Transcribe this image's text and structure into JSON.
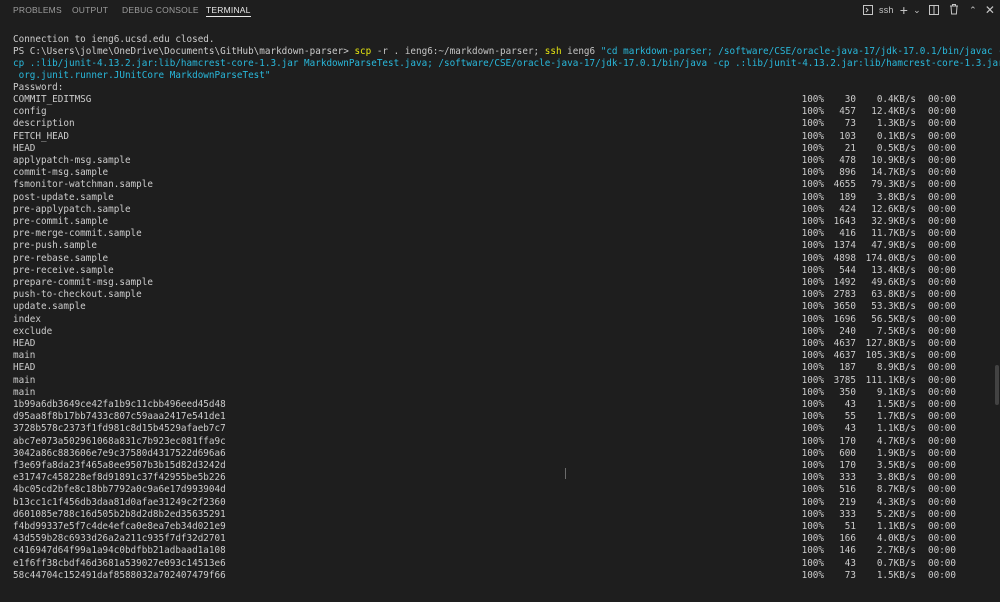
{
  "tabs": [
    {
      "label": "PROBLEMS"
    },
    {
      "label": "OUTPUT"
    },
    {
      "label": "DEBUG CONSOLE"
    },
    {
      "label": "TERMINAL"
    }
  ],
  "toolbar": {
    "shell_label": "ssh",
    "icons": [
      "terminal-icon",
      "plus-icon",
      "chevron-down-icon",
      "split-icon",
      "trash-icon",
      "chevron-up-icon",
      "close-icon"
    ]
  },
  "terminal": {
    "pre_lines": [
      "Connection to ieng6.ucsd.edu closed."
    ],
    "prompt": "PS C:\\Users\\jolme\\OneDrive\\Documents\\GitHub\\markdown-parser> ",
    "cmd_part1": "scp",
    "cmd_part2": " -r . ieng6:~/markdown-parser; ",
    "cmd_part3": "ssh",
    "cmd_part4": " ieng6 ",
    "cmd_str_1": "\"cd markdown-parser; /software/CSE/oracle-java-17/jdk-17.0.1/bin/javac -",
    "cmd_str_2": "cp .:lib/junit-4.13.2.jar:lib/hamcrest-core-1.3.jar MarkdownParseTest.java; /software/CSE/oracle-java-17/jdk-17.0.1/bin/java -cp .:lib/junit-4.13.2.jar:lib/hamcrest-core-1.3.jar",
    "cmd_str_3": " org.junit.runner.JUnitCore MarkdownParseTest\"",
    "password_line": "Password:",
    "transfers": [
      {
        "name": "COMMIT_EDITMSG",
        "pct": "100%",
        "size": "30",
        "speed": "0.4KB/s",
        "eta": "00:00"
      },
      {
        "name": "config",
        "pct": "100%",
        "size": "457",
        "speed": "12.4KB/s",
        "eta": "00:00"
      },
      {
        "name": "description",
        "pct": "100%",
        "size": "73",
        "speed": "1.3KB/s",
        "eta": "00:00"
      },
      {
        "name": "FETCH_HEAD",
        "pct": "100%",
        "size": "103",
        "speed": "0.1KB/s",
        "eta": "00:00"
      },
      {
        "name": "HEAD",
        "pct": "100%",
        "size": "21",
        "speed": "0.5KB/s",
        "eta": "00:00"
      },
      {
        "name": "applypatch-msg.sample",
        "pct": "100%",
        "size": "478",
        "speed": "10.9KB/s",
        "eta": "00:00"
      },
      {
        "name": "commit-msg.sample",
        "pct": "100%",
        "size": "896",
        "speed": "14.7KB/s",
        "eta": "00:00"
      },
      {
        "name": "fsmonitor-watchman.sample",
        "pct": "100%",
        "size": "4655",
        "speed": "79.3KB/s",
        "eta": "00:00"
      },
      {
        "name": "post-update.sample",
        "pct": "100%",
        "size": "189",
        "speed": "3.8KB/s",
        "eta": "00:00"
      },
      {
        "name": "pre-applypatch.sample",
        "pct": "100%",
        "size": "424",
        "speed": "12.6KB/s",
        "eta": "00:00"
      },
      {
        "name": "pre-commit.sample",
        "pct": "100%",
        "size": "1643",
        "speed": "32.9KB/s",
        "eta": "00:00"
      },
      {
        "name": "pre-merge-commit.sample",
        "pct": "100%",
        "size": "416",
        "speed": "11.7KB/s",
        "eta": "00:00"
      },
      {
        "name": "pre-push.sample",
        "pct": "100%",
        "size": "1374",
        "speed": "47.9KB/s",
        "eta": "00:00"
      },
      {
        "name": "pre-rebase.sample",
        "pct": "100%",
        "size": "4898",
        "speed": "174.0KB/s",
        "eta": "00:00"
      },
      {
        "name": "pre-receive.sample",
        "pct": "100%",
        "size": "544",
        "speed": "13.4KB/s",
        "eta": "00:00"
      },
      {
        "name": "prepare-commit-msg.sample",
        "pct": "100%",
        "size": "1492",
        "speed": "49.6KB/s",
        "eta": "00:00"
      },
      {
        "name": "push-to-checkout.sample",
        "pct": "100%",
        "size": "2783",
        "speed": "63.8KB/s",
        "eta": "00:00"
      },
      {
        "name": "update.sample",
        "pct": "100%",
        "size": "3650",
        "speed": "53.3KB/s",
        "eta": "00:00"
      },
      {
        "name": "index",
        "pct": "100%",
        "size": "1696",
        "speed": "56.5KB/s",
        "eta": "00:00"
      },
      {
        "name": "exclude",
        "pct": "100%",
        "size": "240",
        "speed": "7.5KB/s",
        "eta": "00:00"
      },
      {
        "name": "HEAD",
        "pct": "100%",
        "size": "4637",
        "speed": "127.8KB/s",
        "eta": "00:00"
      },
      {
        "name": "main",
        "pct": "100%",
        "size": "4637",
        "speed": "105.3KB/s",
        "eta": "00:00"
      },
      {
        "name": "HEAD",
        "pct": "100%",
        "size": "187",
        "speed": "8.9KB/s",
        "eta": "00:00"
      },
      {
        "name": "main",
        "pct": "100%",
        "size": "3785",
        "speed": "111.1KB/s",
        "eta": "00:00"
      },
      {
        "name": "main",
        "pct": "100%",
        "size": "350",
        "speed": "9.1KB/s",
        "eta": "00:00"
      },
      {
        "name": "1b99a6db3649ce42fa1b9c11cbb496eed45d48",
        "pct": "100%",
        "size": "43",
        "speed": "1.5KB/s",
        "eta": "00:00"
      },
      {
        "name": "d95aa8f8b17bb7433c807c59aaa2417e541de1",
        "pct": "100%",
        "size": "55",
        "speed": "1.7KB/s",
        "eta": "00:00"
      },
      {
        "name": "3728b578c2373f1fd981c8d15b4529afaeb7c7",
        "pct": "100%",
        "size": "43",
        "speed": "1.1KB/s",
        "eta": "00:00"
      },
      {
        "name": "abc7e073a502961068a831c7b923ec081ffa9c",
        "pct": "100%",
        "size": "170",
        "speed": "4.7KB/s",
        "eta": "00:00"
      },
      {
        "name": "3042a86c883606e7e9c37580d4317522d696a6",
        "pct": "100%",
        "size": "600",
        "speed": "1.9KB/s",
        "eta": "00:00"
      },
      {
        "name": "f3e69fa8da23f465a8ee9507b3b15d82d3242d",
        "pct": "100%",
        "size": "170",
        "speed": "3.5KB/s",
        "eta": "00:00"
      },
      {
        "name": "e31747c458228ef8d91891c37f42955be5b226",
        "pct": "100%",
        "size": "333",
        "speed": "3.8KB/s",
        "eta": "00:00"
      },
      {
        "name": "4bc05cd2bfe8c18bb7792a0c9a6e17d993904d",
        "pct": "100%",
        "size": "516",
        "speed": "8.7KB/s",
        "eta": "00:00"
      },
      {
        "name": "b13cc1c1f456db3daa81d0afae31249c2f2360",
        "pct": "100%",
        "size": "219",
        "speed": "4.3KB/s",
        "eta": "00:00"
      },
      {
        "name": "d601085e788c16d505b2b8d2d8b2ed35635291",
        "pct": "100%",
        "size": "333",
        "speed": "5.2KB/s",
        "eta": "00:00"
      },
      {
        "name": "f4bd99337e5f7c4de4efca0e8ea7eb34d021e9",
        "pct": "100%",
        "size": "51",
        "speed": "1.1KB/s",
        "eta": "00:00"
      },
      {
        "name": "43d559b28c6933d26a2a211c935f7df32d2701",
        "pct": "100%",
        "size": "166",
        "speed": "4.0KB/s",
        "eta": "00:00"
      },
      {
        "name": "c416947d64f99a1a94c0bdfbb21adbaad1a108",
        "pct": "100%",
        "size": "146",
        "speed": "2.7KB/s",
        "eta": "00:00"
      },
      {
        "name": "e1f6ff38cbdf46d3681a539027e093c14513e6",
        "pct": "100%",
        "size": "43",
        "speed": "0.7KB/s",
        "eta": "00:00"
      },
      {
        "name": "58c44704c152491daf8588032a702407479f66",
        "pct": "100%",
        "size": "73",
        "speed": "1.5KB/s",
        "eta": "00:00"
      }
    ]
  }
}
